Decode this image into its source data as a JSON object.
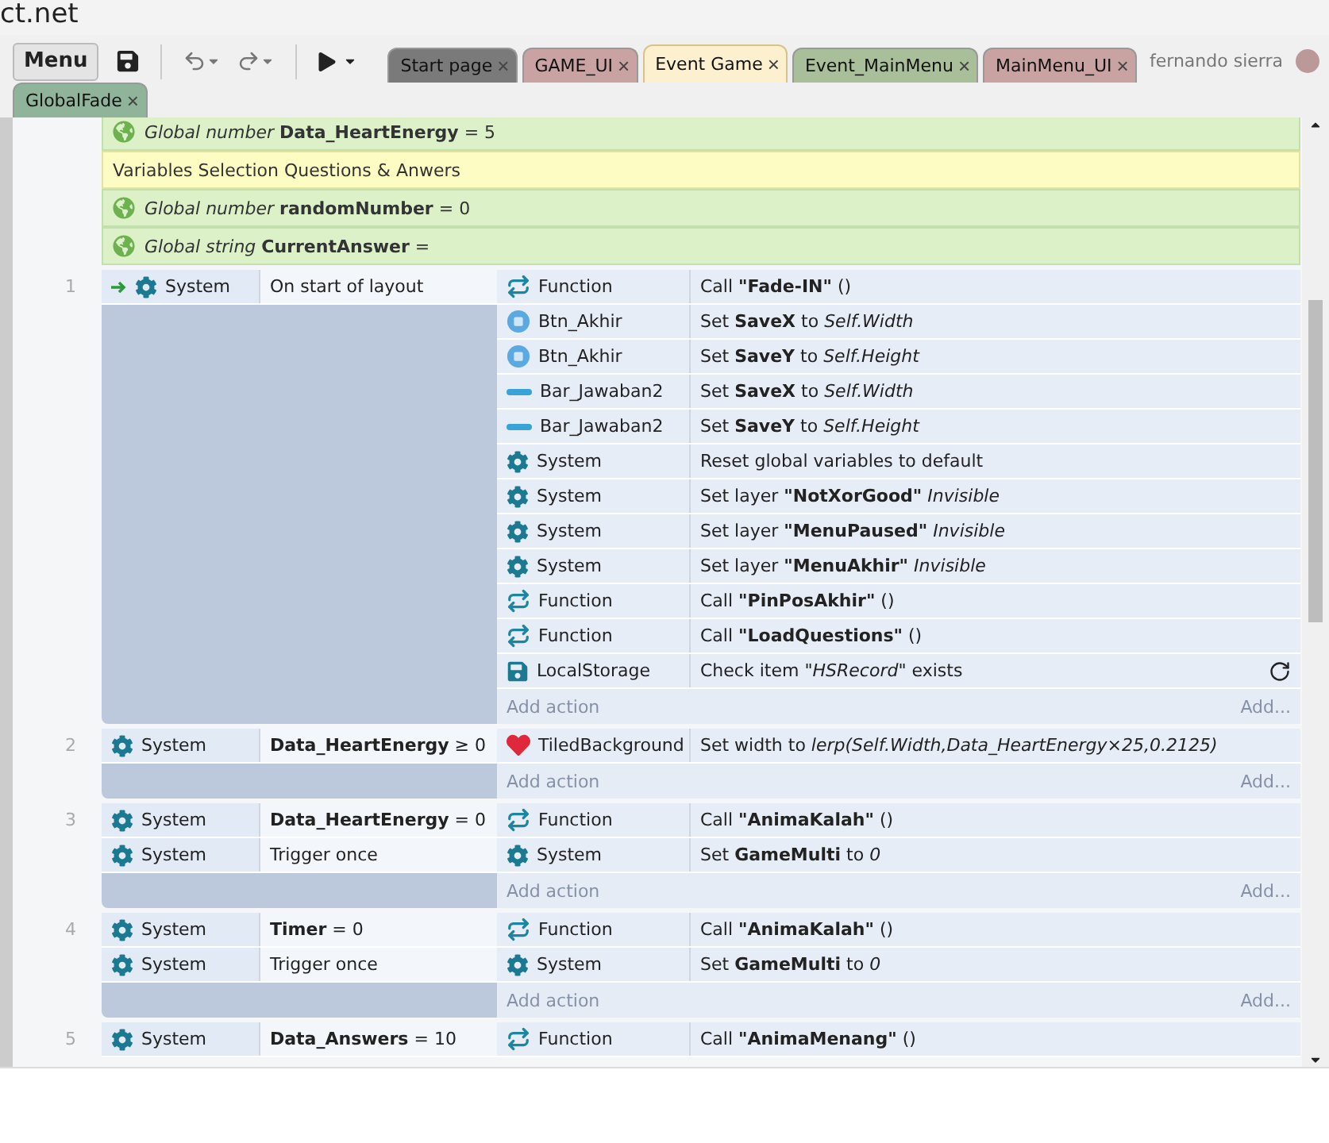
{
  "browser": {
    "title": "ct.net"
  },
  "toolbar": {
    "menu": "Menu",
    "user": "fernando sierra"
  },
  "tabs": [
    {
      "label": "Start page",
      "color": "#7a7a7a",
      "selected": false,
      "close": "×"
    },
    {
      "label": "GAME_UI",
      "color": "#c9a2a2",
      "selected": false,
      "close": "×"
    },
    {
      "label": "Event Game",
      "color": "#fdf0cf",
      "selected": true,
      "close": "×"
    },
    {
      "label": "Event_MainMenu",
      "color": "#a9bf99",
      "selected": false,
      "close": "×"
    },
    {
      "label": "MainMenu_UI",
      "color": "#c9a2a2",
      "selected": false,
      "close": "×"
    },
    {
      "label": "GlobalFade",
      "color": "#8fb49a",
      "selected": false,
      "close": "×"
    }
  ],
  "variables": [
    {
      "kind": "global",
      "text": "*Global number* **Data_HeartEnergy** = 5"
    },
    {
      "kind": "comment",
      "text": "Variables Selection Questions & Anwers"
    },
    {
      "kind": "global",
      "text": "*Global number* **randomNumber** = 0"
    },
    {
      "kind": "global",
      "text": "*Global string* **CurrentAnswer** ="
    }
  ],
  "events": [
    {
      "number": "1",
      "add_action": "Add action",
      "add_more": "Add...",
      "conditions": [
        {
          "trigger": true,
          "kind": "system",
          "object": "System",
          "text": "On start of layout"
        }
      ],
      "actions": [
        {
          "kind": "function",
          "object": "Function",
          "text": "Call **\"Fade-IN\"** ()",
          "async": false
        },
        {
          "kind": "sprite",
          "object": "Btn_Akhir",
          "text": "Set **SaveX** to *Self.Width*",
          "async": false
        },
        {
          "kind": "sprite",
          "object": "Btn_Akhir",
          "text": "Set **SaveY** to *Self.Height*",
          "async": false
        },
        {
          "kind": "bar",
          "object": "Bar_Jawaban2",
          "text": "Set **SaveX** to *Self.Width*",
          "async": false
        },
        {
          "kind": "bar",
          "object": "Bar_Jawaban2",
          "text": "Set **SaveY** to *Self.Height*",
          "async": false
        },
        {
          "kind": "system",
          "object": "System",
          "text": "Reset global variables to default",
          "async": false
        },
        {
          "kind": "system",
          "object": "System",
          "text": "Set layer **\"NotXorGood\"** *Invisible*",
          "async": false
        },
        {
          "kind": "system",
          "object": "System",
          "text": "Set layer **\"MenuPaused\"** *Invisible*",
          "async": false
        },
        {
          "kind": "system",
          "object": "System",
          "text": "Set layer **\"MenuAkhir\"** *Invisible*",
          "async": false
        },
        {
          "kind": "function",
          "object": "Function",
          "text": "Call **\"PinPosAkhir\"** ()",
          "async": false
        },
        {
          "kind": "function",
          "object": "Function",
          "text": "Call **\"LoadQuestions\"** ()",
          "async": false
        },
        {
          "kind": "storage",
          "object": "LocalStorage",
          "text": "Check item *\"HSRecord\"* exists",
          "async": true
        }
      ]
    },
    {
      "number": "2",
      "add_action": "Add action",
      "add_more": "Add...",
      "conditions": [
        {
          "trigger": false,
          "kind": "system",
          "object": "System",
          "text": "**Data_HeartEnergy** ≥ 0"
        }
      ],
      "actions": [
        {
          "kind": "heart",
          "object": "TiledBackground",
          "text": "Set width to *lerp(Self.Width,Data_HeartEnergy×25,0.2125)*",
          "async": false
        }
      ]
    },
    {
      "number": "3",
      "add_action": "Add action",
      "add_more": "Add...",
      "conditions": [
        {
          "trigger": false,
          "kind": "system",
          "object": "System",
          "text": "**Data_HeartEnergy** = 0"
        },
        {
          "trigger": false,
          "kind": "system",
          "object": "System",
          "text": "Trigger once"
        }
      ],
      "actions": [
        {
          "kind": "function",
          "object": "Function",
          "text": "Call **\"AnimaKalah\"** ()",
          "async": false
        },
        {
          "kind": "system",
          "object": "System",
          "text": "Set **GameMulti** to *0*",
          "async": false
        }
      ]
    },
    {
      "number": "4",
      "add_action": "Add action",
      "add_more": "Add...",
      "conditions": [
        {
          "trigger": false,
          "kind": "system",
          "object": "System",
          "text": "**Timer** = 0"
        },
        {
          "trigger": false,
          "kind": "system",
          "object": "System",
          "text": "Trigger once"
        }
      ],
      "actions": [
        {
          "kind": "function",
          "object": "Function",
          "text": "Call **\"AnimaKalah\"** ()",
          "async": false
        },
        {
          "kind": "system",
          "object": "System",
          "text": "Set **GameMulti** to *0*",
          "async": false
        }
      ]
    },
    {
      "number": "5",
      "conditions": [
        {
          "trigger": false,
          "kind": "system",
          "object": "System",
          "text": "**Data_Answers** = 10"
        }
      ],
      "actions": [
        {
          "kind": "function",
          "object": "Function",
          "text": "Call **\"AnimaMenang\"** ()",
          "async": false
        }
      ]
    }
  ]
}
